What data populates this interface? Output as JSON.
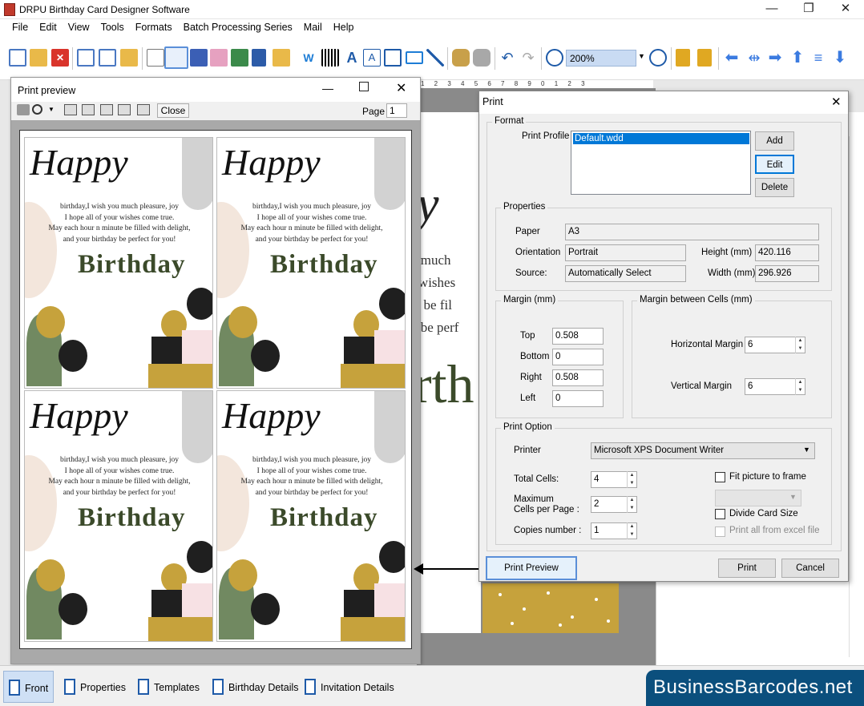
{
  "window": {
    "title": "DRPU Birthday Card Designer Software",
    "minimize_glyph": "—",
    "maximize_glyph": "❐",
    "close_glyph": "✕"
  },
  "menu": [
    "File",
    "Edit",
    "View",
    "Tools",
    "Formats",
    "Batch Processing Series",
    "Mail",
    "Help"
  ],
  "toolbar": {
    "zoom_value": "200%",
    "icons": [
      "new-icon",
      "open-icon",
      "close-file-icon",
      "save-icon",
      "save-as-icon",
      "open-folder-icon",
      "properties-icon",
      "print-icon",
      "layers-icon",
      "gift-icon",
      "picture-icon",
      "pen-icon",
      "shapes-icon",
      "word-art-icon",
      "barcode-icon",
      "text-icon",
      "image-text-icon",
      "signature-icon",
      "envelope-icon",
      "line-icon",
      "database-icon",
      "database-2-icon",
      "undo-icon",
      "redo-icon",
      "zoom-in-icon",
      "zoom-out-icon",
      "lock-icon",
      "unlock-icon",
      "arrow-left-icon",
      "flip-icon",
      "arrow-right-icon",
      "arrow-up-icon",
      "align-icon",
      "arrow-down-icon"
    ]
  },
  "canvas": {
    "heading_fragment": "y",
    "lines": [
      "u much",
      "r wishes",
      "te be fil",
      "y be perf"
    ],
    "birthday_fragment": "rth"
  },
  "print_preview": {
    "title": "Print preview",
    "close_label": "Close",
    "page_label": "Page",
    "page_value": "1",
    "cards": [
      {
        "happy": "Happy",
        "message": [
          "birthday,I wish you much pleasure, joy",
          "I hope all of your wishes come true.",
          "May each hour n minute be filled with delight,",
          "and your birthday be perfect for you!"
        ],
        "birthday": "Birthday"
      },
      {
        "happy": "Happy",
        "message": [
          "birthday,I wish you much pleasure, joy",
          "I hope all of your wishes come true.",
          "May each hour n minute be filled with delight,",
          "and your birthday be perfect for you!"
        ],
        "birthday": "Birthday"
      },
      {
        "happy": "Happy",
        "message": [
          "birthday,I wish you much pleasure, joy",
          "I hope all of your wishes come true.",
          "May each hour n minute be filled with delight,",
          "and your birthday be perfect for you!"
        ],
        "birthday": "Birthday"
      },
      {
        "happy": "Happy",
        "message": [
          "birthday,I wish you much pleasure, joy",
          "I hope all of your wishes come true.",
          "May each hour n minute be filled with delight,",
          "and your birthday be perfect for you!"
        ],
        "birthday": "Birthday"
      }
    ]
  },
  "print_dialog": {
    "title": "Print",
    "format_legend": "Format",
    "print_profile_label": "Print Profile",
    "profile_selected": "Default.wdd",
    "add_label": "Add",
    "edit_label": "Edit",
    "delete_label": "Delete",
    "properties_legend": "Properties",
    "paper_label": "Paper",
    "paper_value": "A3",
    "orientation_label": "Orientation",
    "orientation_value": "Portrait",
    "source_label": "Source:",
    "source_value": "Automatically Select",
    "height_label": "Height (mm)",
    "height_value": "420.116",
    "width_label": "Width (mm)",
    "width_value": "296.926",
    "margin_legend": "Margin (mm)",
    "top_label": "Top",
    "top_value": "0.508",
    "bottom_label": "Bottom",
    "bottom_value": "0",
    "right_label": "Right",
    "right_value": "0.508",
    "left_label": "Left",
    "left_value": "0",
    "cells_legend": "Margin between Cells (mm)",
    "hmargin_label": "Horizontal Margin",
    "hmargin_value": "6",
    "vmargin_label": "Vertical Margin",
    "vmargin_value": "6",
    "option_legend": "Print Option",
    "printer_label": "Printer",
    "printer_value": "Microsoft XPS Document Writer",
    "total_cells_label": "Total Cells:",
    "total_cells_value": "4",
    "max_cells_label_1": "Maximum",
    "max_cells_label_2": "Cells per Page :",
    "max_cells_value": "2",
    "copies_label": "Copies number :",
    "copies_value": "1",
    "fit_label": "Fit picture to frame",
    "divide_label": "Divide Card Size",
    "excel_label": "Print all from excel file",
    "preview_label": "Print Preview",
    "print_label": "Print",
    "cancel_label": "Cancel"
  },
  "bottom_tabs": [
    "Front",
    "Properties",
    "Templates",
    "Birthday Details",
    "Invitation Details"
  ],
  "brand": "BusinessBarcodes.net",
  "colors": {
    "accent": "#0078d7",
    "brand_bg": "#0b4f7d",
    "gold": "#c6a23c",
    "text_green": "#3b4a2a"
  }
}
